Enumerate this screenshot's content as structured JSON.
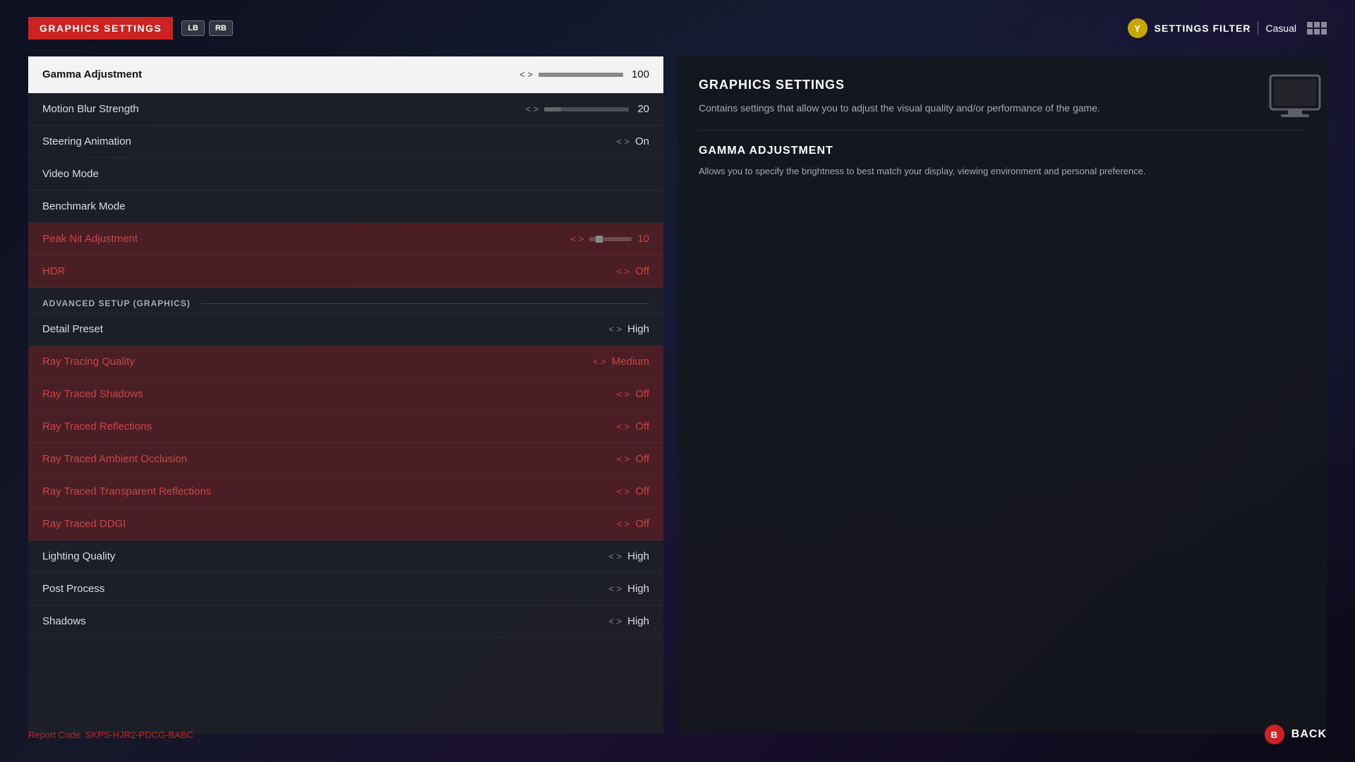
{
  "header": {
    "title": "GRAPHICS SETTINGS",
    "nav_left": "LB",
    "nav_right": "RB",
    "y_button": "Y",
    "filter_label": "SETTINGS FILTER",
    "filter_value": "Casual"
  },
  "settings": {
    "rows": [
      {
        "name": "Gamma Adjustment",
        "value": "100",
        "type": "slider_full",
        "highlighted": false,
        "active_row": true
      },
      {
        "name": "Motion Blur Strength",
        "value": "20",
        "type": "slider_low",
        "highlighted": false
      },
      {
        "name": "Steering Animation",
        "value": "On",
        "type": "select",
        "highlighted": false
      },
      {
        "name": "Video Mode",
        "value": "",
        "type": "empty",
        "highlighted": false
      },
      {
        "name": "Benchmark Mode",
        "value": "",
        "type": "empty",
        "highlighted": false
      },
      {
        "name": "Peak Nit Adjustment",
        "value": "10",
        "type": "slider_dot",
        "highlighted": true
      },
      {
        "name": "HDR",
        "value": "Off",
        "type": "select",
        "highlighted": true
      }
    ],
    "advanced_section": "ADVANCED SETUP (GRAPHICS)",
    "advanced_rows": [
      {
        "name": "Detail Preset",
        "value": "High",
        "type": "select",
        "highlighted": false
      },
      {
        "name": "Ray Tracing Quality",
        "value": "Medium",
        "type": "select",
        "highlighted": true
      },
      {
        "name": "Ray Traced Shadows",
        "value": "Off",
        "type": "select",
        "highlighted": true
      },
      {
        "name": "Ray Traced Reflections",
        "value": "Off",
        "type": "select",
        "highlighted": true
      },
      {
        "name": "Ray Traced Ambient Occlusion",
        "value": "Off",
        "type": "select",
        "highlighted": true
      },
      {
        "name": "Ray Traced Transparent Reflections",
        "value": "Off",
        "type": "select",
        "highlighted": true
      },
      {
        "name": "Ray Traced DDGI",
        "value": "Off",
        "type": "select",
        "highlighted": true
      },
      {
        "name": "Lighting Quality",
        "value": "High",
        "type": "select",
        "highlighted": false
      },
      {
        "name": "Post Process",
        "value": "High",
        "type": "select",
        "highlighted": false
      },
      {
        "name": "Shadows",
        "value": "High",
        "type": "select",
        "highlighted": false
      }
    ]
  },
  "info_panel": {
    "title": "GRAPHICS SETTINGS",
    "description": "Contains settings that allow you to adjust the visual quality and/or performance of the game.",
    "sub_title": "GAMMA ADJUSTMENT",
    "sub_description": "Allows you to specify the brightness to best match your display, viewing environment and personal preference."
  },
  "footer": {
    "report_code": "Report Code: SKPS-HJR2-PDCG-BABC",
    "back_label": "BACK",
    "b_button": "B"
  }
}
